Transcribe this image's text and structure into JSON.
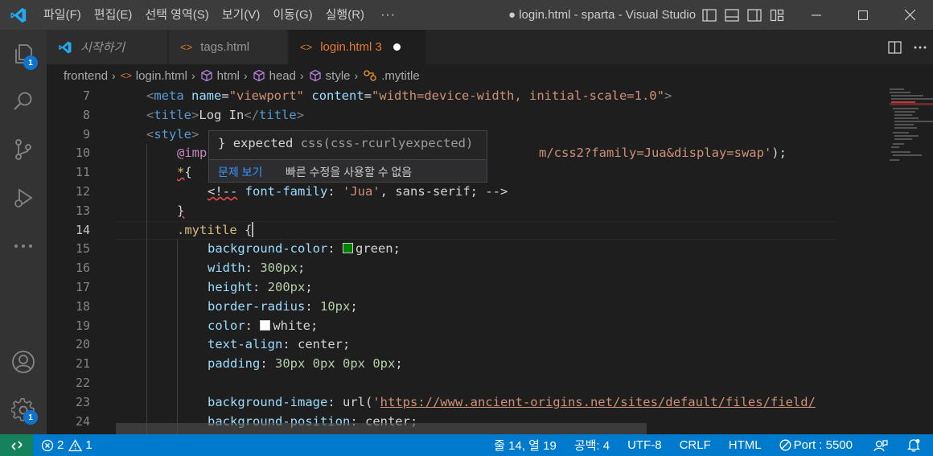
{
  "menu": [
    "파일(F)",
    "편집(E)",
    "선택 영역(S)",
    "보기(V)",
    "이동(G)",
    "실행(R)"
  ],
  "menu_more": "···",
  "window_title": "● login.html - sparta - Visual Studio Code",
  "activity": {
    "explorer_badge": "1",
    "accounts_badge": "1"
  },
  "tabs": [
    {
      "label": "시작하기",
      "icon": "vscode-icon"
    },
    {
      "label": "tags.html",
      "icon": "html-icon"
    },
    {
      "label": "login.html 3",
      "icon": "html-icon",
      "active": true,
      "dirty": true
    }
  ],
  "breadcrumb": [
    {
      "label": "frontend",
      "icon": ""
    },
    {
      "label": "login.html",
      "icon": "html-icon"
    },
    {
      "label": "html",
      "icon": "cube-icon"
    },
    {
      "label": "head",
      "icon": "cube-icon"
    },
    {
      "label": "style",
      "icon": "cube-icon"
    },
    {
      "label": ".mytitle",
      "icon": "symbol-class-icon"
    }
  ],
  "line_numbers": [
    "7",
    "8",
    "9",
    "10",
    "11",
    "12",
    "13",
    "14",
    "15",
    "16",
    "17",
    "18",
    "19",
    "20",
    "21",
    "22",
    "23",
    "24"
  ],
  "current_line": "14",
  "code": {
    "l7_a": "<",
    "l7_tag": "meta",
    "l7_attr1": "name",
    "l7_eq1": "=",
    "l7_val1": "\"viewport\"",
    "l7_attr2": "content",
    "l7_eq2": "=",
    "l7_val2": "\"width=device-width, initial-scale=1.0\"",
    "l7_b": ">",
    "l8_a": "<",
    "l8_tag": "title",
    "l8_b": ">",
    "l8_text": "Log In",
    "l8_c": "</",
    "l8_tag2": "title",
    "l8_d": ">",
    "l9_a": "<",
    "l9_tag": "style",
    "l9_b": ">",
    "l10_at": "@imp",
    "l10_rest": "m/css2?family=Jua&display=swap'",
    "l10_end": ");",
    "l11_sel": "*",
    "l11_brace": "{",
    "l12_comment": "<!--",
    "l12_prop": "font-family",
    "l12_colon": ": ",
    "l12_val": "'Jua'",
    "l12_rest": ", sans-serif; -->",
    "l13_brace": "}",
    "l14_sel": ".mytitle",
    "l14_brace": " {",
    "l15_prop": "background-color",
    "l15_val": "green",
    "l15_color": "#008000",
    "l16_prop": "width",
    "l16_val": "300px",
    "l17_prop": "height",
    "l17_val": "200px",
    "l18_prop": "border-radius",
    "l18_val": "10px",
    "l19_prop": "color",
    "l19_val": "white",
    "l19_color": "#ffffff",
    "l20_prop": "text-align",
    "l20_val": "center",
    "l21_prop": "padding",
    "l21_val": "30px 0px 0px 0px",
    "l23_prop": "background-image",
    "l23_fn": "url(",
    "l23_url": "https://www.ancient-origins.net/sites/default/files/field/",
    "l24_prop": "background-position",
    "l24_val": "center"
  },
  "hover": {
    "brace": "}",
    "message": "expected",
    "source": "css(css-rcurlyexpected)",
    "view_problem": "문제 보기",
    "no_quick_fix": "빠른 수정을 사용할 수 없음"
  },
  "status": {
    "errors": "2",
    "warnings": "1",
    "position": "줄 14, 열 19",
    "spaces": "공백: 4",
    "encoding": "UTF-8",
    "eol": "CRLF",
    "language": "HTML",
    "port": "Port : 5500"
  },
  "colors": {
    "statusbar": "#007acc",
    "remote": "#16825d",
    "active_tab_text": "#e37933"
  }
}
